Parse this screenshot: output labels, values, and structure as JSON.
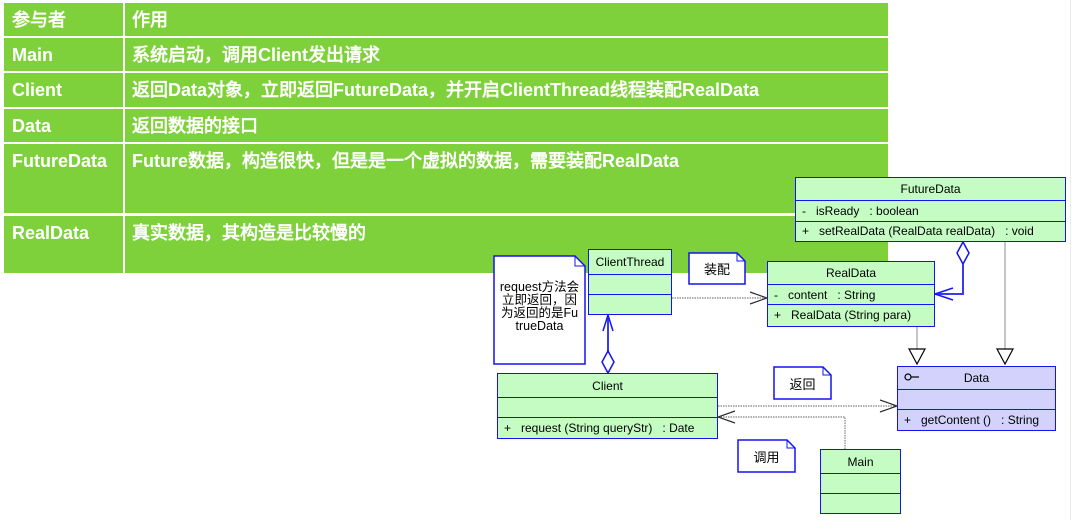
{
  "colors": {
    "table_green": "#7fd13b",
    "table_text": "#ffffff",
    "class_fill": "#c4fcc4",
    "interface_fill": "#d2d2fc",
    "class_border": "#1414f0",
    "connector_gray": "#808080"
  },
  "table": {
    "headers": {
      "role": "参与者",
      "purpose": "作用"
    },
    "rows": [
      {
        "role": "Main",
        "purpose": "系统启动，调用Client发出请求"
      },
      {
        "role": "Client",
        "purpose": "返回Data对象，立即返回FutureData，并开启ClientThread线程装配RealData"
      },
      {
        "role": "Data",
        "purpose": "返回数据的接口"
      },
      {
        "role": "FutureData",
        "purpose": "Future数据，构造很快，但是是一个虚拟的数据，需要装配RealData"
      },
      {
        "role": "RealData",
        "purpose": "真实数据，其构造是比较慢的"
      }
    ]
  },
  "diagram": {
    "classes": {
      "futuredata": {
        "name": "FutureData",
        "attributes": [
          "-   isReady   : boolean"
        ],
        "methods": [
          "+   setRealData (RealData realData)   : void"
        ]
      },
      "realdata": {
        "name": "RealData",
        "attributes": [
          "-   content   : String"
        ],
        "methods": [
          "+   RealData (String para)"
        ]
      },
      "clientthread": {
        "name": "ClientThread",
        "attributes": [],
        "methods": []
      },
      "client": {
        "name": "Client",
        "attributes": [],
        "methods": [
          "+   request (String queryStr)   : Date"
        ]
      },
      "data": {
        "name": "Data",
        "stereotype_icon": "interface-lollipop-icon",
        "attributes": [],
        "methods": [
          "+   getContent ()   : String"
        ]
      },
      "main": {
        "name": "Main",
        "attributes": [],
        "methods": []
      }
    },
    "notes": {
      "request": {
        "lines": [
          "request方法会",
          "立即返回，因",
          "为返回的是Fu",
          "trueData"
        ]
      },
      "assemble": {
        "text": "装配"
      },
      "return": {
        "text": "返回"
      },
      "call": {
        "text": "调用"
      }
    },
    "relationships": [
      {
        "from": "ClientThread",
        "to": "RealData",
        "type": "dependency"
      },
      {
        "from": "FutureData",
        "to": "RealData",
        "type": "aggregation"
      },
      {
        "from": "RealData",
        "to": "Data",
        "type": "realization"
      },
      {
        "from": "FutureData",
        "to": "Data",
        "type": "realization"
      },
      {
        "from": "Client",
        "to": "ClientThread",
        "type": "aggregation"
      },
      {
        "from": "Client",
        "to": "Data",
        "type": "dependency"
      },
      {
        "from": "Main",
        "to": "Client",
        "type": "association"
      }
    ]
  }
}
